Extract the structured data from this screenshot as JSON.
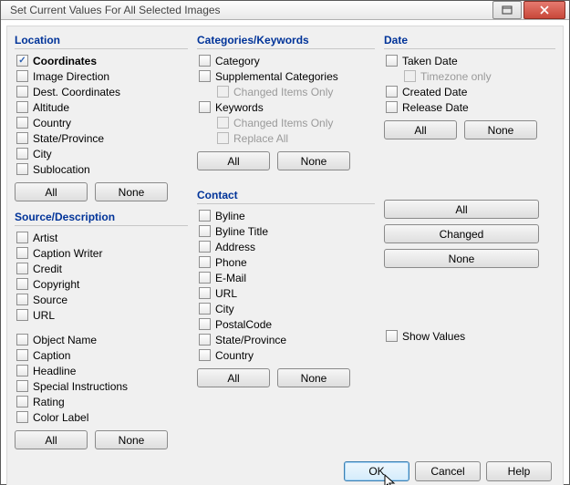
{
  "window": {
    "title": "Set Current Values For All Selected Images"
  },
  "groups": {
    "location": {
      "title": "Location",
      "items": {
        "coordinates": {
          "checked": true,
          "bold": true,
          "label": "Coordinates"
        },
        "image_direction": {
          "checked": false,
          "label": "Image Direction"
        },
        "dest_coordinates": {
          "checked": false,
          "label": "Dest. Coordinates"
        },
        "altitude": {
          "checked": false,
          "label": "Altitude"
        },
        "country": {
          "checked": false,
          "label": "Country"
        },
        "state_province": {
          "checked": false,
          "label": "State/Province"
        },
        "city": {
          "checked": false,
          "label": "City"
        },
        "sublocation": {
          "checked": false,
          "label": "Sublocation"
        }
      },
      "buttons": {
        "all": "All",
        "none": "None"
      }
    },
    "source": {
      "title": "Source/Description",
      "items1": {
        "artist": {
          "label": "Artist"
        },
        "caption_writer": {
          "label": "Caption Writer"
        },
        "credit": {
          "label": "Credit"
        },
        "copyright": {
          "label": "Copyright"
        },
        "source": {
          "label": "Source"
        },
        "url": {
          "label": "URL"
        }
      },
      "items2": {
        "object_name": {
          "label": "Object Name"
        },
        "caption": {
          "label": "Caption"
        },
        "headline": {
          "label": "Headline"
        },
        "special_instructions": {
          "label": "Special Instructions"
        },
        "rating": {
          "label": "Rating"
        },
        "color_label": {
          "label": "Color Label"
        }
      },
      "buttons": {
        "all": "All",
        "none": "None"
      }
    },
    "categories": {
      "title": "Categories/Keywords",
      "items": {
        "category": {
          "label": "Category"
        },
        "supplemental_categories": {
          "label": "Supplemental Categories"
        },
        "sc_changed_only": {
          "label": "Changed Items Only",
          "disabled": true,
          "indent": true
        },
        "keywords": {
          "label": "Keywords"
        },
        "kw_changed_only": {
          "label": "Changed Items Only",
          "disabled": true,
          "indent": true
        },
        "kw_replace_all": {
          "label": "Replace All",
          "disabled": true,
          "indent": true
        }
      },
      "buttons": {
        "all": "All",
        "none": "None"
      }
    },
    "contact": {
      "title": "Contact",
      "items": {
        "byline": {
          "label": "Byline"
        },
        "byline_title": {
          "label": "Byline Title"
        },
        "address": {
          "label": "Address"
        },
        "phone": {
          "label": "Phone"
        },
        "email": {
          "label": "E-Mail"
        },
        "url": {
          "label": "URL"
        },
        "city": {
          "label": "City"
        },
        "postalcode": {
          "label": "PostalCode"
        },
        "state_province": {
          "label": "State/Province"
        },
        "country": {
          "label": "Country"
        }
      },
      "buttons": {
        "all": "All",
        "none": "None"
      }
    },
    "date": {
      "title": "Date",
      "items": {
        "taken_date": {
          "label": "Taken Date"
        },
        "timezone_only": {
          "label": "Timezone only",
          "disabled": true,
          "indent": true
        },
        "created_date": {
          "label": "Created Date"
        },
        "release_date": {
          "label": "Release Date"
        }
      },
      "buttons": {
        "all": "All",
        "none": "None"
      }
    }
  },
  "right": {
    "all": "All",
    "changed": "Changed",
    "none": "None",
    "show_values": "Show Values"
  },
  "footer": {
    "ok": "OK",
    "cancel": "Cancel",
    "help": "Help"
  }
}
